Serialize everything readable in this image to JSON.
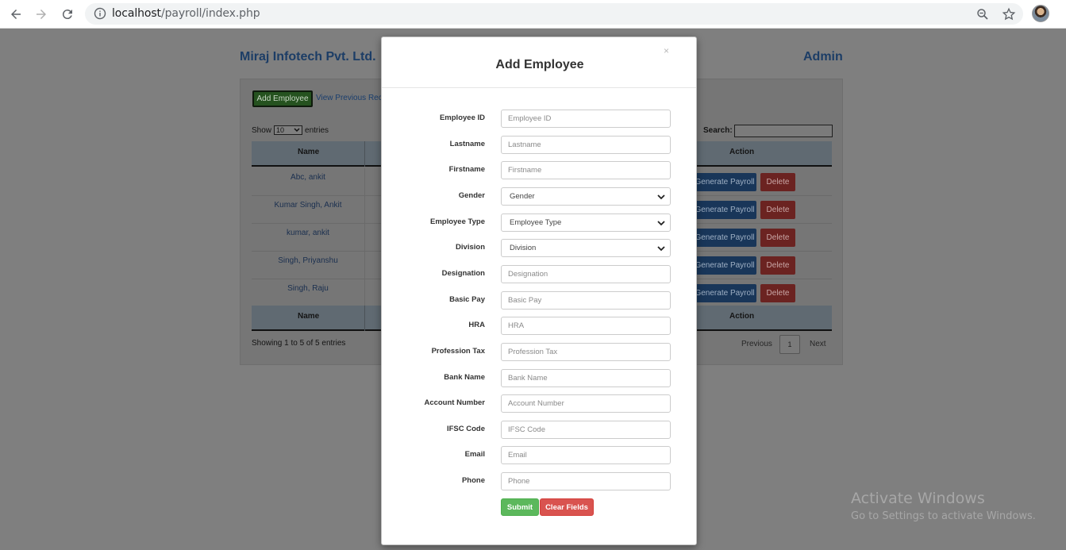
{
  "browser": {
    "url_host": "localhost",
    "url_path": "/payroll/index.php"
  },
  "page": {
    "company": "Miraj Infotech Pvt. Ltd.",
    "user": "Admin",
    "add_employee_label": "Add Employee",
    "view_previous_label": "View Previous Reco",
    "show_label": "Show",
    "show_value": "10",
    "entries_label": "entries",
    "search_label": "Search:",
    "table": {
      "columns": [
        "Name",
        "Action"
      ],
      "rows": [
        {
          "name": "Abc, ankit"
        },
        {
          "name": "Kumar Singh, Ankit"
        },
        {
          "name": "kumar, ankit"
        },
        {
          "name": "Singh, Priyanshu"
        },
        {
          "name": "Singh, Raju"
        }
      ],
      "generate_label": "Generate Payroll",
      "delete_label": "Delete"
    },
    "info": "Showing 1 to 5 of 5 entries",
    "pagination": {
      "previous": "Previous",
      "current": "1",
      "next": "Next"
    }
  },
  "watermark": {
    "line1": "Activate Windows",
    "line2": "Go to Settings to activate Windows."
  },
  "modal": {
    "close": "×",
    "title": "Add Employee",
    "fields": [
      {
        "label": "Employee ID",
        "placeholder": "Employee ID",
        "type": "input"
      },
      {
        "label": "Lastname",
        "placeholder": "Lastname",
        "type": "input"
      },
      {
        "label": "Firstname",
        "placeholder": "Firstname",
        "type": "input"
      },
      {
        "label": "Gender",
        "placeholder": "Gender",
        "type": "select"
      },
      {
        "label": "Employee Type",
        "placeholder": "Employee Type",
        "type": "select"
      },
      {
        "label": "Division",
        "placeholder": "Division",
        "type": "select"
      },
      {
        "label": "Designation",
        "placeholder": "Designation",
        "type": "input"
      },
      {
        "label": "Basic Pay",
        "placeholder": "Basic Pay",
        "type": "input"
      },
      {
        "label": "HRA",
        "placeholder": "HRA",
        "type": "input"
      },
      {
        "label": "Profession Tax",
        "placeholder": "Profession Tax",
        "type": "input"
      },
      {
        "label": "Bank Name",
        "placeholder": "Bank Name",
        "type": "input"
      },
      {
        "label": "Account Number",
        "placeholder": "Account Number",
        "type": "input"
      },
      {
        "label": "IFSC Code",
        "placeholder": "IFSC Code",
        "type": "input"
      },
      {
        "label": "Email",
        "placeholder": "Email",
        "type": "input"
      },
      {
        "label": "Phone",
        "placeholder": "Phone",
        "type": "input"
      }
    ],
    "submit_label": "Submit",
    "clear_label": "Clear Fields"
  },
  "colors": {
    "submit": "#5cb85c",
    "clear": "#d9534f",
    "brand": "#1c3d66"
  }
}
